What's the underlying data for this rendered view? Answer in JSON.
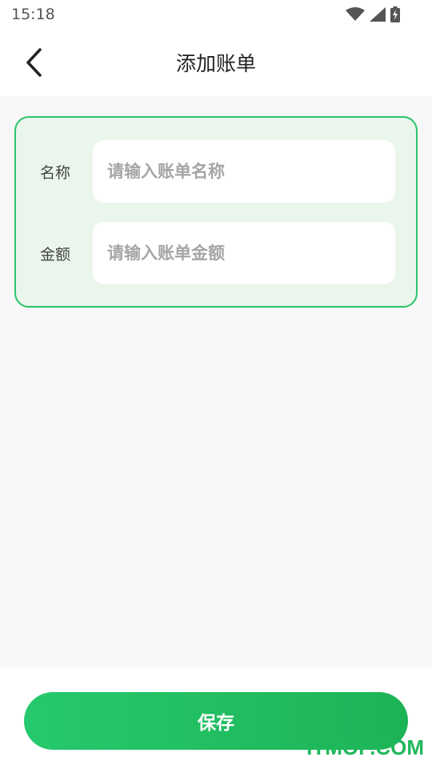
{
  "status_bar": {
    "time": "15:18",
    "icons": [
      "wifi-icon",
      "signal-icon",
      "battery-charging-icon"
    ]
  },
  "header": {
    "title": "添加账单",
    "back_icon": "chevron-left-icon"
  },
  "form": {
    "name_label": "名称",
    "name_placeholder": "请输入账单名称",
    "name_value": "",
    "amount_label": "金额",
    "amount_placeholder": "请输入账单金额",
    "amount_value": ""
  },
  "footer": {
    "save_label": "保存"
  },
  "watermark": "ITMOP.COM",
  "colors": {
    "accent": "#2cc36b",
    "card_bg": "#eaf6ec",
    "page_bg": "#f8f8f8"
  }
}
